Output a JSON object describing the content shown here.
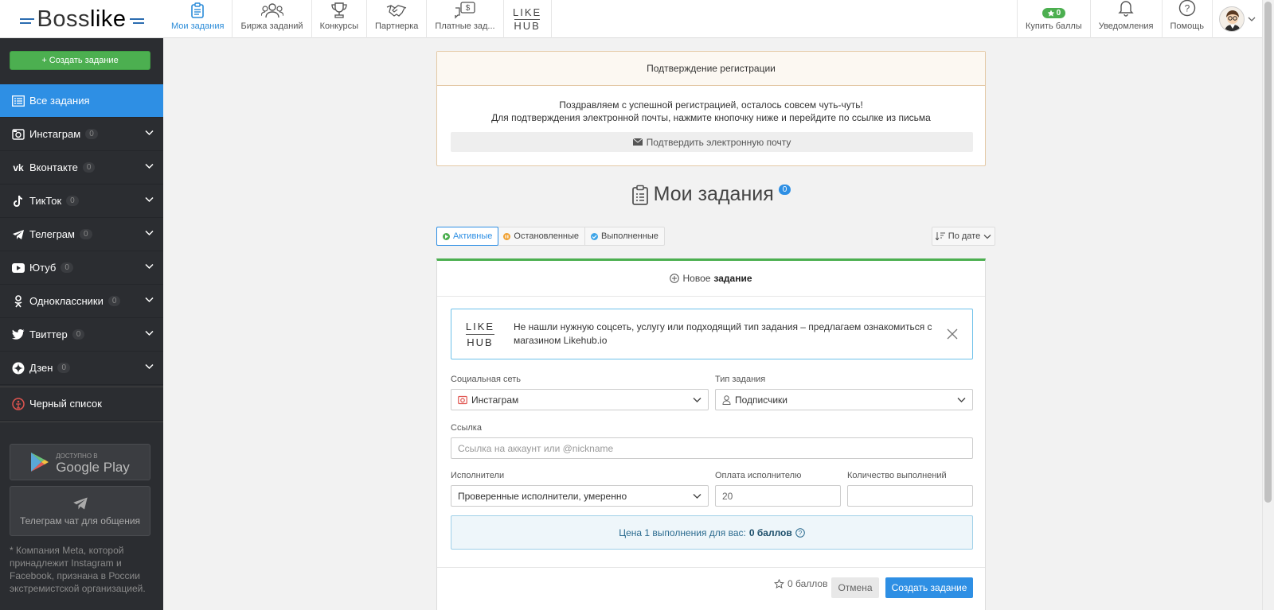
{
  "logo": {
    "text_pre": "Boss",
    "text_post": "like"
  },
  "nav": [
    {
      "label": "Мои задания",
      "icon": "clipboard-icon"
    },
    {
      "label": "Биржа заданий",
      "icon": "users-icon"
    },
    {
      "label": "Конкурсы",
      "icon": "trophy-icon"
    },
    {
      "label": "Партнерка",
      "icon": "handshake-icon"
    },
    {
      "label": "Платные зад...",
      "icon": "money-chat-icon"
    }
  ],
  "likehub": {
    "top": "LIKE",
    "bottom": "HUB"
  },
  "rightnav": {
    "buy_points": {
      "label": "Купить баллы",
      "badge": "0"
    },
    "notifications": {
      "label": "Уведомления"
    },
    "help": {
      "label": "Помощь"
    }
  },
  "sidebar": {
    "create_button": "+ Создать задание",
    "items": [
      {
        "label": "Все задания",
        "count": null
      },
      {
        "label": "Инстаграм",
        "count": "0"
      },
      {
        "label": "Вконтакте",
        "count": "0"
      },
      {
        "label": "ТикТок",
        "count": "0"
      },
      {
        "label": "Телеграм",
        "count": "0"
      },
      {
        "label": "Ютуб",
        "count": "0"
      },
      {
        "label": "Одноклассники",
        "count": "0"
      },
      {
        "label": "Твиттер",
        "count": "0"
      },
      {
        "label": "Дзен",
        "count": "0"
      }
    ],
    "blacklist": "Черный список",
    "google_play_small": "ДОСТУПНО В",
    "google_play_big": "Google Play",
    "telegram_chat": "Телеграм чат для общения",
    "meta_note": "* Компания Meta, которой принадлежит Instagram и Facebook, признана в России экстремистской организацией."
  },
  "confirm": {
    "title": "Подтверждение регистрации",
    "line1": "Поздравляем с успешной регистрацией, осталось совсем чуть-чуть!",
    "line2": "Для подтверждения электронной почты, нажмите кнопочку ниже и перейдите по ссылке из письма",
    "button": "Подтвердить электронную почту"
  },
  "page": {
    "title": "Мои задания",
    "badge": "0"
  },
  "filters": {
    "active": "Активные",
    "stopped": "Остановленные",
    "done": "Выполненные",
    "sort": "По дате"
  },
  "task": {
    "head_pre": "Новое",
    "head_bold": "задание",
    "banner_text": "Не нашли нужную соцсеть, услугу или подходящий тип задания – предлагаем ознакомиться с магазином Likehub.io",
    "social_label": "Социальная сеть",
    "social_value": "Инстаграм",
    "type_label": "Тип задания",
    "type_value": "Подписчики",
    "link_label": "Ссылка",
    "link_placeholder": "Ссылка на аккаунт или @nickname",
    "performers_label": "Исполнители",
    "performers_value": "Проверенные исполнители, умеренно",
    "pay_label": "Оплата исполнителю",
    "pay_value": "20",
    "qty_label": "Количество выполнений",
    "qty_value": "",
    "price_text": "Цена 1 выполнения для вас:",
    "price_value": "0 баллов",
    "footer_points": "0 баллов",
    "cancel": "Отмена",
    "create": "Создать задание"
  },
  "colors": {
    "accent": "#2e8fe4",
    "green": "#4caf50",
    "sidebar": "#2b2d31"
  }
}
